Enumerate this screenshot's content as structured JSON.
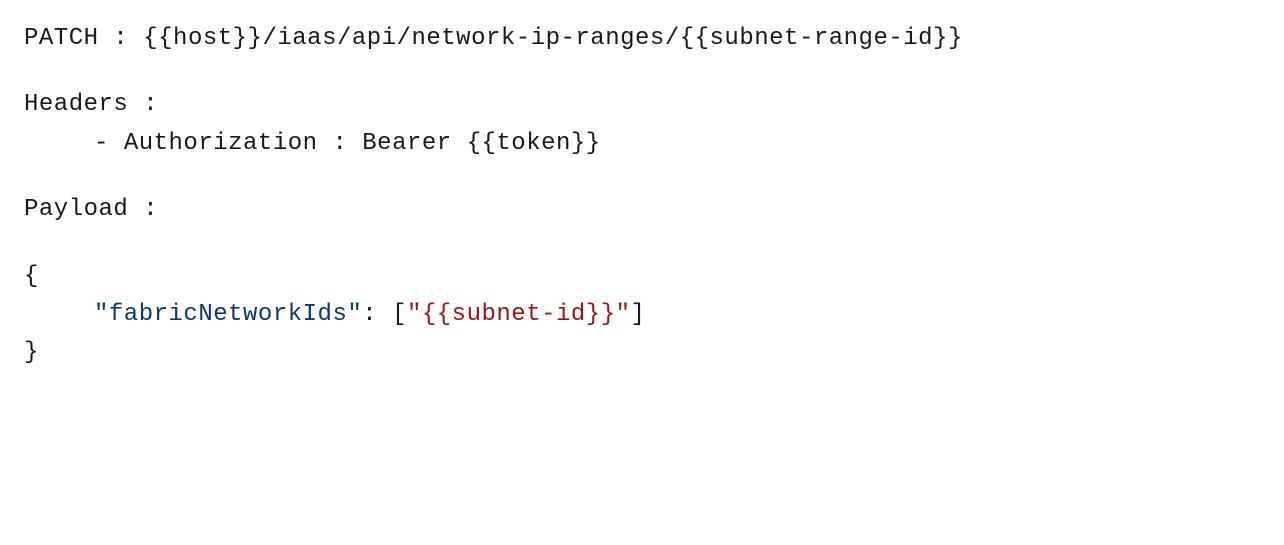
{
  "request": {
    "method": "PATCH",
    "separator": " : ",
    "url": "{{host}}/iaas/api/network-ip-ranges/{{subnet-range-id}}"
  },
  "headers": {
    "label": "Headers :",
    "items": [
      {
        "bullet": "- ",
        "name": "Authorization",
        "separator": " : ",
        "value": "Bearer {{token}}"
      }
    ]
  },
  "payload": {
    "label": "Payload :",
    "body": {
      "open": "{",
      "key_quote_open": "\"",
      "key": "fabricNetworkIds",
      "key_quote_close": "\"",
      "colon": ": ",
      "array_open": "[",
      "value_quote_open": "\"",
      "value": "{{subnet-id}}",
      "value_quote_close": "\"",
      "array_close": "]",
      "close": "}"
    }
  }
}
